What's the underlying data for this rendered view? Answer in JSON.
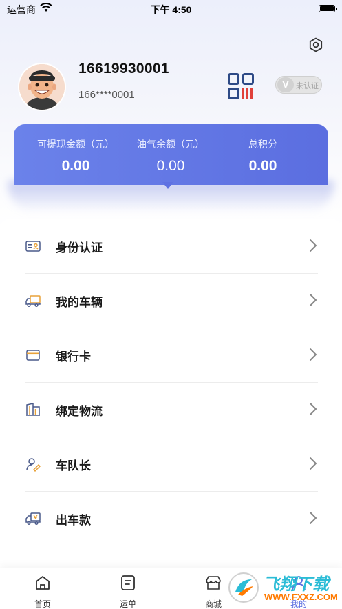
{
  "status_bar": {
    "carrier": "运营商",
    "time": "下午 4:50"
  },
  "profile": {
    "phone": "16619930001",
    "phone_masked": "166****0001",
    "cert_letter": "V",
    "cert_status": "未认证"
  },
  "balances": [
    {
      "label": "可提现金额（元）",
      "value": "0.00"
    },
    {
      "label": "油气余额（元）",
      "value": "0.00"
    },
    {
      "label": "总积分",
      "value": "0.00"
    }
  ],
  "menu": [
    {
      "label": "身份认证",
      "icon": "id-card-icon"
    },
    {
      "label": "我的车辆",
      "icon": "truck-icon"
    },
    {
      "label": "银行卡",
      "icon": "bank-card-icon"
    },
    {
      "label": "绑定物流",
      "icon": "building-icon"
    },
    {
      "label": "车队长",
      "icon": "captain-icon"
    },
    {
      "label": "出车款",
      "icon": "payment-truck-icon"
    }
  ],
  "tabs": [
    {
      "label": "首页",
      "icon": "home-icon"
    },
    {
      "label": "运单",
      "icon": "waybill-icon"
    },
    {
      "label": "商城",
      "icon": "store-icon"
    },
    {
      "label": "我的",
      "icon": "profile-icon"
    }
  ],
  "watermark": {
    "main": "飞翔下载",
    "sub": "WWW.FXXZ.COM"
  },
  "colors": {
    "accent": "#5b6ee0",
    "qr_red": "#e0403a",
    "qr_navy": "#2e4a86"
  }
}
